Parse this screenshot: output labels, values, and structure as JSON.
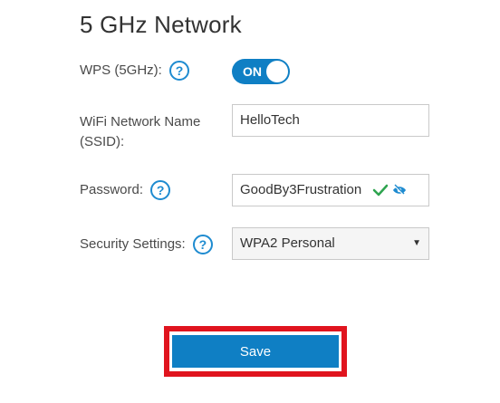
{
  "section": {
    "title": "5 GHz Network"
  },
  "wps": {
    "label": "WPS (5GHz):",
    "toggle_text": "ON"
  },
  "ssid": {
    "label_line1": "WiFi Network Name",
    "label_line2": "(SSID):",
    "value": "HelloTech"
  },
  "password": {
    "label": "Password:",
    "value": "GoodBy3Frustration"
  },
  "security": {
    "label": "Security Settings:",
    "selected": "WPA2 Personal"
  },
  "actions": {
    "save_label": "Save"
  },
  "colors": {
    "accent": "#0f7fc4",
    "help": "#1e8bd0",
    "valid": "#2ea44f",
    "highlight": "#e0141e"
  },
  "icons": {
    "help": "help-icon",
    "check": "check-icon",
    "visibility": "eye-hidden-icon",
    "caret": "caret-down-icon"
  }
}
